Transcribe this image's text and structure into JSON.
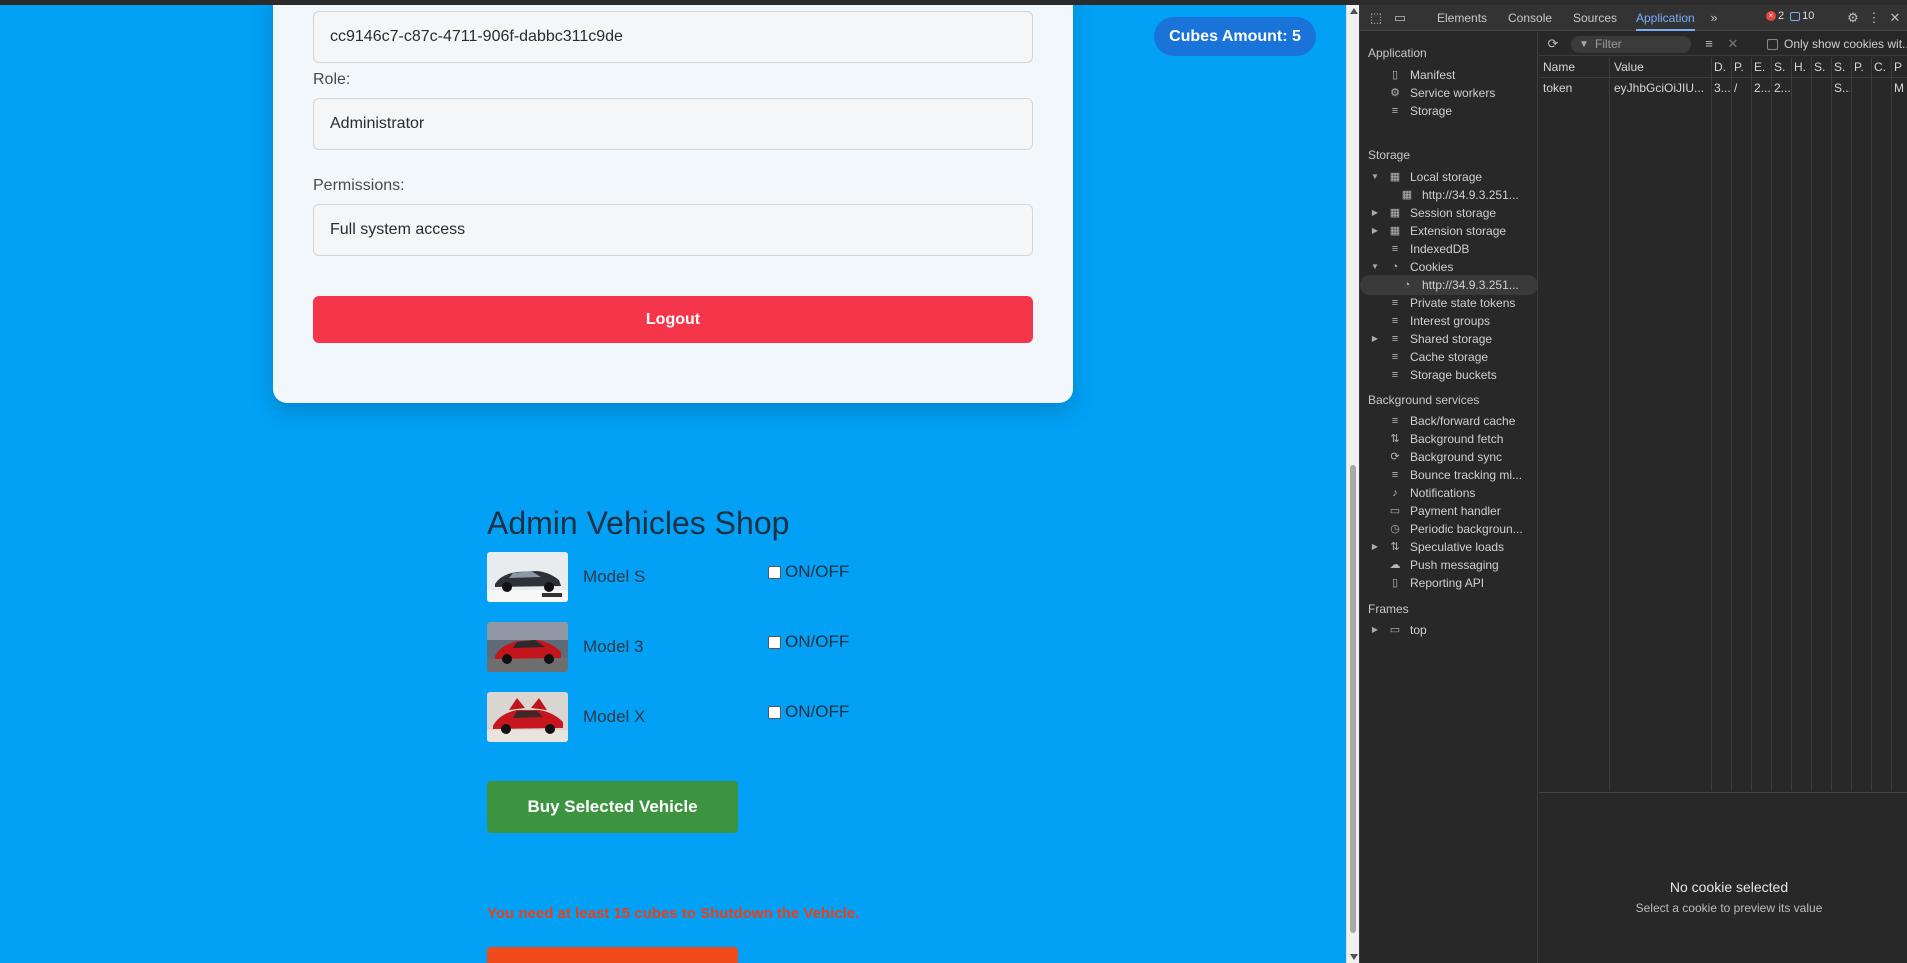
{
  "user_card": {
    "id_value": "cc9146c7-c87c-4711-906f-dabbc311c9de",
    "role_label": "Role:",
    "role_value": "Administrator",
    "permissions_label": "Permissions:",
    "permissions_value": "Full system access",
    "logout_label": "Logout"
  },
  "cubes_badge": "Cubes Amount: 5",
  "shop": {
    "title": "Admin Vehicles Shop",
    "vehicles": [
      {
        "name": "Model S",
        "toggle_label": "ON/OFF"
      },
      {
        "name": "Model 3",
        "toggle_label": "ON/OFF"
      },
      {
        "name": "Model X",
        "toggle_label": "ON/OFF"
      }
    ],
    "buy_label": "Buy Selected Vehicle",
    "warning": "You need at least 15 cubes to Shutdown the Vehicle."
  },
  "devtools": {
    "tabs": [
      "Elements",
      "Console",
      "Sources",
      "Application"
    ],
    "active_tab": "Application",
    "error_count": "2",
    "message_count": "10",
    "sidebar": {
      "application_header": "Application",
      "application_items": [
        "Manifest",
        "Service workers",
        "Storage"
      ],
      "storage_header": "Storage",
      "storage_items": [
        "Local storage",
        "http://34.9.3.251...",
        "Session storage",
        "Extension storage",
        "IndexedDB",
        "Cookies",
        "http://34.9.3.251...",
        "Private state tokens",
        "Interest groups",
        "Shared storage",
        "Cache storage",
        "Storage buckets"
      ],
      "bg_header": "Background services",
      "bg_items": [
        "Back/forward cache",
        "Background fetch",
        "Background sync",
        "Bounce tracking mi...",
        "Notifications",
        "Payment handler",
        "Periodic backgroun...",
        "Speculative loads",
        "Push messaging",
        "Reporting API"
      ],
      "frames_header": "Frames",
      "frames_items": [
        "top"
      ]
    },
    "toolbar": {
      "filter_placeholder": "Filter",
      "only_show": "Only show cookies wit..."
    },
    "cookie_table": {
      "headers": [
        "Name",
        "Value",
        "D.",
        "P.",
        "E.",
        "S.",
        "H.",
        "S.",
        "S.",
        "P.",
        "C.",
        "P"
      ],
      "rows": [
        [
          "token",
          "eyJhbGciOiJIU...",
          "3...",
          "/",
          "2...",
          "2...",
          "",
          "",
          "S...",
          "",
          "",
          "M"
        ]
      ]
    },
    "preview": {
      "title": "No cookie selected",
      "subtitle": "Select a cookie to preview its value"
    }
  },
  "colors": {
    "page_bg": "#02a1f6",
    "logout": "#f5364a",
    "buy": "#3d9440",
    "badge": "#1a73d9",
    "warning": "#e8401a"
  }
}
